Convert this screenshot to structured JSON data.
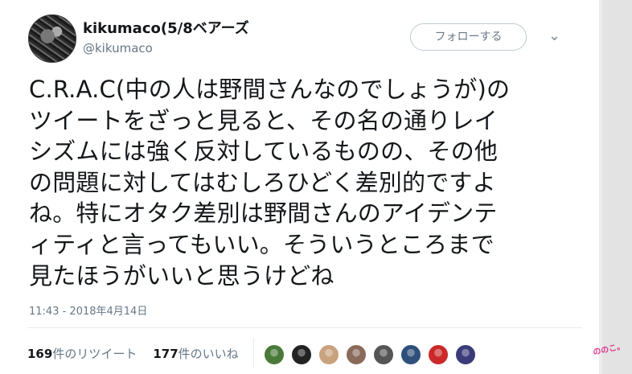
{
  "tweet": {
    "display_name": "kikumaco(5/8ベアーズ",
    "handle": "@kikumaco",
    "follow_label": "フォローする",
    "text_lines": [
      "C.R.A.C(中の人は野間さんなのでしょうが)の",
      "ツイートをざっと見ると、その名の通りレイ",
      "シズムには強く反対しているものの、その他",
      "の問題に対してはむしろひどく差別的ですよ",
      "ね。特にオタク差別は野間さんのアイデンテ",
      "ィティと言ってもいい。そういうところまで",
      "見たほうがいいと思うけどね"
    ],
    "timestamp": "11:43 - 2018年4月14日",
    "retweet_count": "169",
    "retweet_label": "件のリツイート",
    "like_count": "177",
    "like_label": "件のいいね"
  },
  "icons": {
    "more": "chevron-down-icon"
  },
  "liker_avatars": [
    {
      "color": "#4a7a3a"
    },
    {
      "color": "#222222"
    },
    {
      "color": "#c9a27e"
    },
    {
      "color": "#8a6a5a"
    },
    {
      "color": "#555555"
    },
    {
      "color": "#2e4f7a"
    },
    {
      "color": "#cc2a2a"
    },
    {
      "color": "#3b3b7a"
    }
  ],
  "colors": {
    "text": "#14171a",
    "secondary": "#657786",
    "border": "#e6ecf0",
    "watermark": "#e0338a"
  },
  "watermark": {
    "text": "ののこ。"
  }
}
